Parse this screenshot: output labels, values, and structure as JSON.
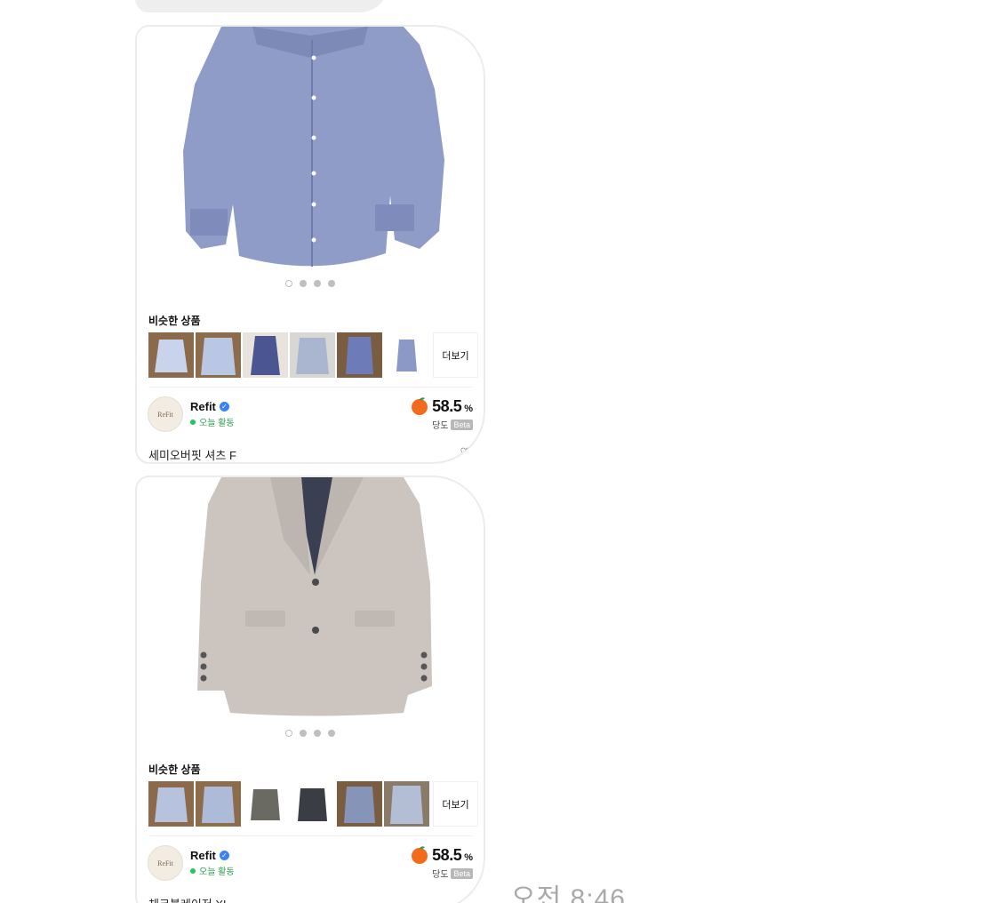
{
  "colors": {
    "accent_blue": "#3b82f6",
    "online_green": "#22c55e",
    "tangerine": "#f26a1b",
    "beta_gray": "#b8b8b8",
    "timestamp_gray": "#a9a9a9"
  },
  "cards": [
    {
      "image_icon": "blue-dress-shirt-photo",
      "carousel_pages": 4,
      "carousel_active_index": 0,
      "similar_title": "비슷한 상품",
      "similar_thumbs": [
        "shirt-thumb",
        "shirt-thumb",
        "shirt-thumb",
        "shirt-thumb",
        "shirt-thumb",
        "shirt-thumb"
      ],
      "more_label": "더보기",
      "seller_name": "Refit",
      "seller_avatar_text": "ReFit",
      "seller_activity": "오늘 활동",
      "sweetness_value": "58.5",
      "sweetness_unit": "%",
      "sweetness_label": "당도",
      "beta_label": "Beta",
      "item_title": "세미오버핏 셔츠 F"
    },
    {
      "image_icon": "check-blazer-photo",
      "carousel_pages": 4,
      "carousel_active_index": 0,
      "similar_title": "비슷한 상품",
      "similar_thumbs": [
        "blazer-thumb",
        "blazer-thumb",
        "blazer-thumb",
        "blazer-thumb",
        "blazer-thumb",
        "blazer-thumb"
      ],
      "more_label": "더보기",
      "seller_name": "Refit",
      "seller_avatar_text": "ReFit",
      "seller_activity": "오늘 활동",
      "sweetness_value": "58.5",
      "sweetness_unit": "%",
      "sweetness_label": "당도",
      "beta_label": "Beta",
      "item_title": "체크블레이저 XL"
    }
  ],
  "timestamp": "오전 8:46"
}
